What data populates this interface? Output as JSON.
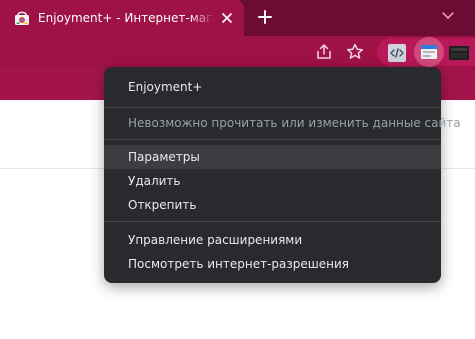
{
  "browser": {
    "tab": {
      "title": "Enjoyment+ - Интернет-магазин Chrome"
    },
    "colors": {
      "tabstrip": "#6d0c33",
      "active_tab": "#9f1245",
      "toolbar": "#9f1245",
      "menu_bg": "#292a2d",
      "menu_text": "#e8eaed",
      "menu_disabled": "#9aa0a6"
    },
    "icons": {
      "favicon": "chrome-web-store-icon",
      "close": "close-icon",
      "new_tab": "plus-icon",
      "tab_search": "chevron-down-icon",
      "share": "share-icon",
      "bookmark": "star-icon",
      "ext1": "code-extension-icon",
      "ext2": "enjoyment-extension-icon",
      "ext3": "dark-extension-icon"
    }
  },
  "context_menu": {
    "title": "Enjoyment+",
    "permission_note": "Невозможно прочитать или изменить данные сайта",
    "options": "Параметры",
    "remove": "Удалить",
    "unpin": "Открепить",
    "manage": "Управление расширениями",
    "view_permissions": "Посмотреть интернет-разрешения"
  }
}
